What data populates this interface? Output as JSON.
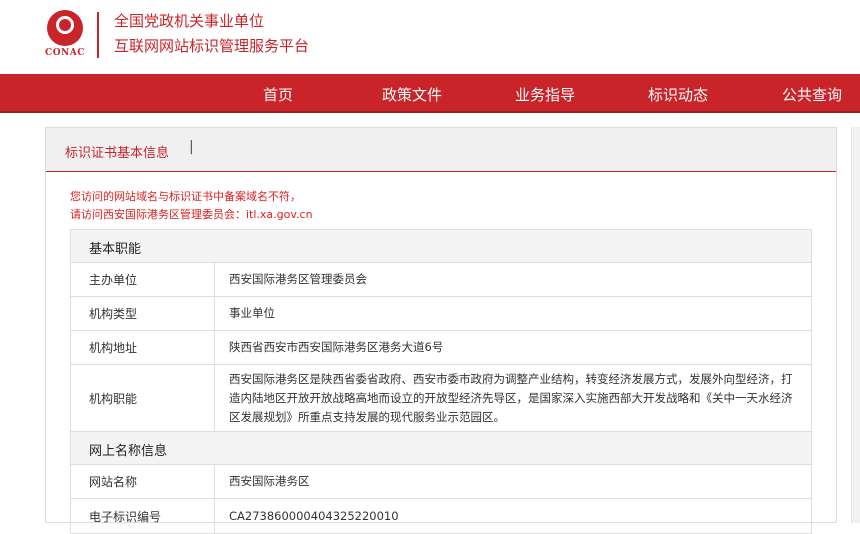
{
  "header": {
    "logo_text": "CONAC",
    "title_line1": "全国党政机关事业单位",
    "title_line2": "互联网网站标识管理服务平台"
  },
  "nav": {
    "items": [
      "首页",
      "政策文件",
      "业务指导",
      "标识动态",
      "公共查询"
    ]
  },
  "panel": {
    "title": "标识证书基本信息",
    "separator": "|"
  },
  "warning": {
    "line1": "您访问的网站域名与标识证书中备案域名不符，",
    "line2": "请访问西安国际港务区管理委员会：itl.xa.gov.cn"
  },
  "sections": {
    "basic": {
      "title": "基本职能",
      "rows": [
        {
          "label": "主办单位",
          "value": "西安国际港务区管理委员会"
        },
        {
          "label": "机构类型",
          "value": "事业单位"
        },
        {
          "label": "机构地址",
          "value": "陕西省西安市西安国际港务区港务大道6号"
        },
        {
          "label": "机构职能",
          "value": "西安国际港务区是陕西省委省政府、西安市委市政府为调整产业结构，转变经济发展方式，发展外向型经济，打造内陆地区开放开放战略高地而设立的开放型经济先导区，是国家深入实施西部大开发战略和《关中一天水经济区发展规划》所重点支持发展的现代服务业示范园区。"
        }
      ]
    },
    "online": {
      "title": "网上名称信息",
      "rows": [
        {
          "label": "网站名称",
          "value": "西安国际港务区"
        },
        {
          "label": "电子标识编号",
          "value": "CA273860000404325220010"
        }
      ]
    }
  },
  "colors": {
    "brand_red": "#c8242a",
    "warning_red": "#e02020"
  }
}
